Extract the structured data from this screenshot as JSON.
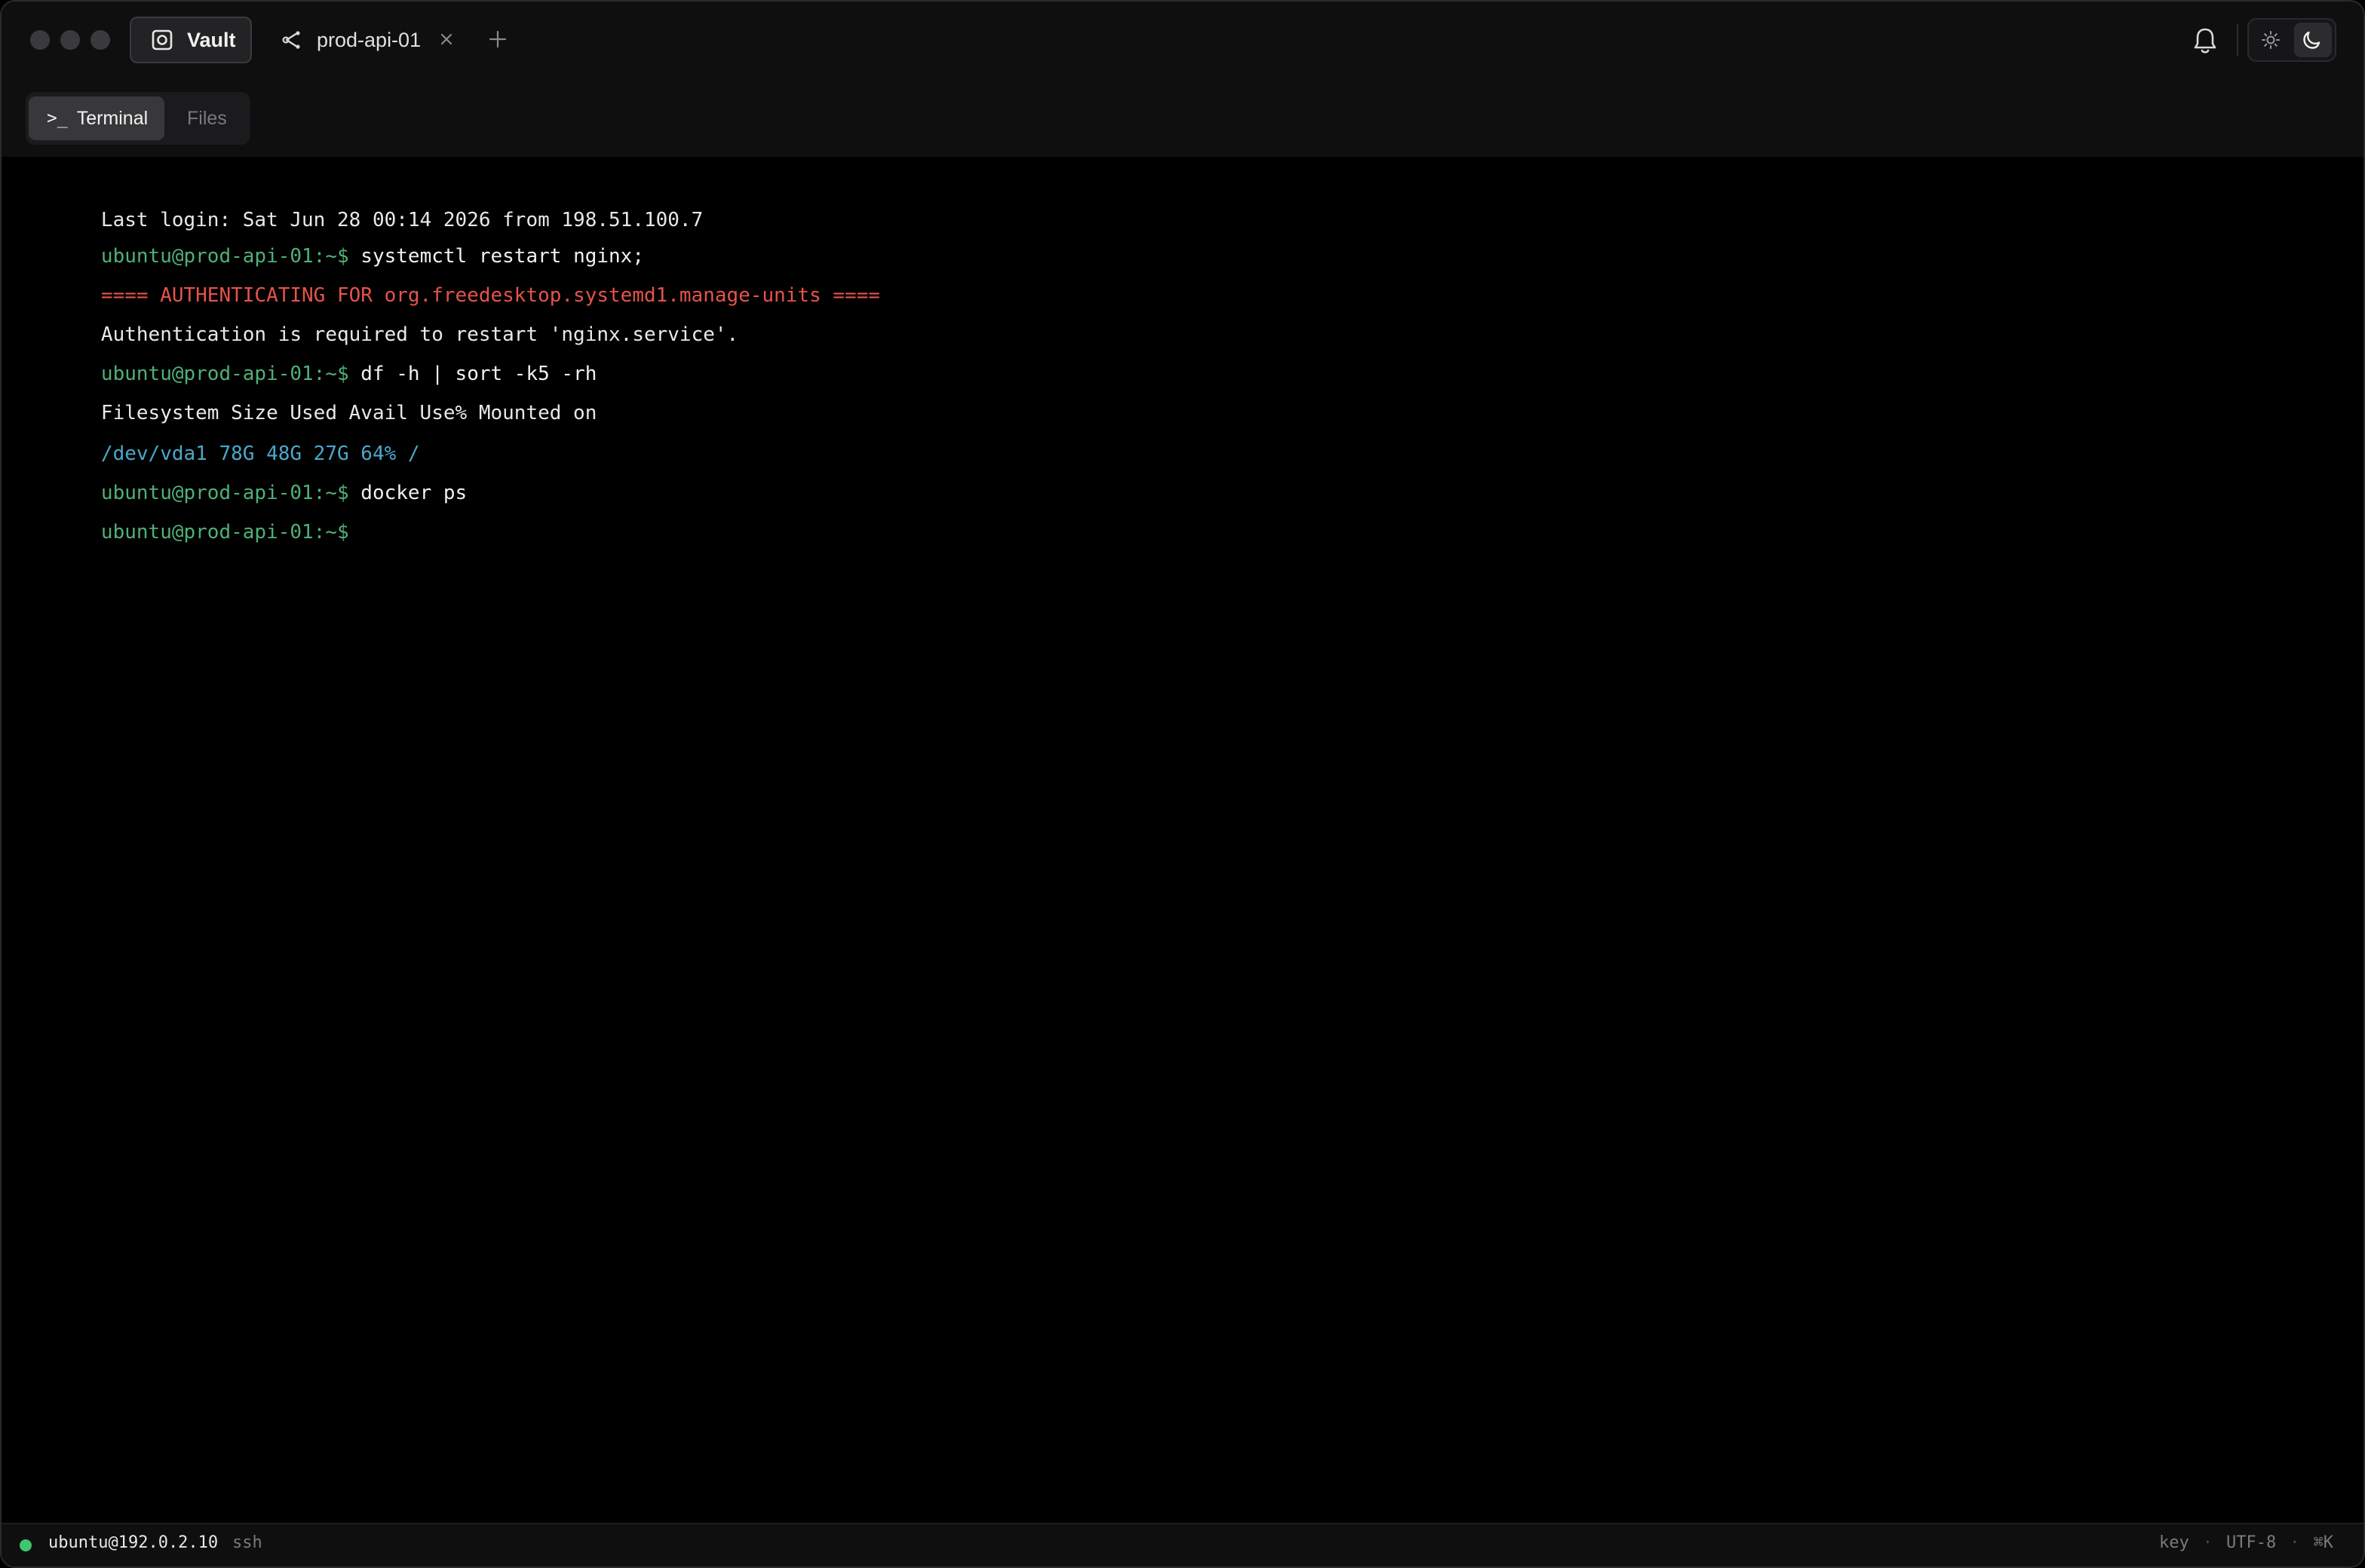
{
  "titlebar": {
    "tabs": [
      {
        "label": "Vault",
        "icon": "vault-icon"
      },
      {
        "label": "prod-api-01",
        "icon": "ssh-host-icon"
      }
    ],
    "close_glyph": "×",
    "add_glyph": "+"
  },
  "subbar": {
    "segments": [
      {
        "label": "Terminal",
        "glyph": ">_"
      },
      {
        "label": "Files"
      }
    ]
  },
  "terminal": {
    "lines": [
      {
        "text": "Last login: Sat Jun 28 00:14 2026 from 198.51.100.7"
      },
      {
        "prompt": "ubuntu@prod-api-01:~$",
        "command": " systemctl restart nginx;"
      },
      {
        "text": "==== AUTHENTICATING FOR org.freedesktop.systemd1.manage-units ===="
      },
      {
        "text": "Authentication is required to restart 'nginx.service'."
      },
      {
        "prompt": "ubuntu@prod-api-01:~$",
        "command": " df -h | sort -k5 -rh"
      },
      {
        "text": "Filesystem Size Used Avail Use% Mounted on"
      },
      {
        "text": "/dev/vda1 78G 48G 27G 64% /"
      },
      {
        "prompt": "ubuntu@prod-api-01:~$",
        "command": " docker ps"
      },
      {
        "prompt": "ubuntu@prod-api-01:~$",
        "command": ""
      }
    ]
  },
  "statusbar": {
    "host": "ubuntu@192.0.2.10",
    "protocol": "ssh",
    "auth": "key",
    "separator": "·",
    "encoding": "UTF-8",
    "shortcut": "⌘K"
  },
  "colors": {
    "prompt": "#4fb077",
    "error": "#e5534b",
    "info": "#4aa8c8",
    "status_ok": "#3ec76e"
  }
}
